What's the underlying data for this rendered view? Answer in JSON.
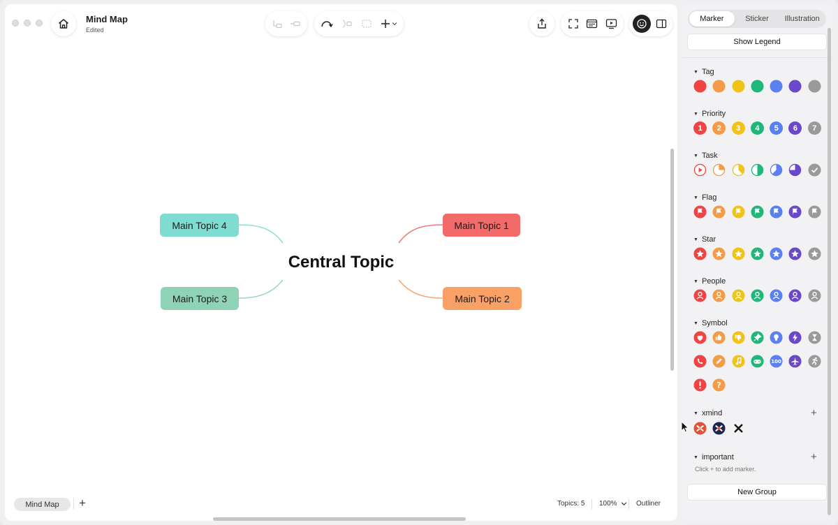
{
  "window": {
    "title": "Mind Map",
    "subtitle": "Edited"
  },
  "map": {
    "central": "Central Topic",
    "topics": [
      {
        "label": "Main Topic 1",
        "color": "#f36a6a"
      },
      {
        "label": "Main Topic 2",
        "color": "#f8a066"
      },
      {
        "label": "Main Topic 3",
        "color": "#8ed3b6"
      },
      {
        "label": "Main Topic 4",
        "color": "#7fdcd0"
      }
    ]
  },
  "bottom": {
    "sheet_tab": "Mind Map",
    "add_sheet": "+",
    "topics_count": "Topics: 5",
    "zoom": "100%",
    "outliner": "Outliner"
  },
  "panel": {
    "tabs": [
      "Marker",
      "Sticker",
      "Illustration"
    ],
    "active_tab": "Marker",
    "show_legend": "Show Legend",
    "new_group": "New Group",
    "important_hint": "Click + to add marker.",
    "palette": [
      "#ef4444",
      "#f59a45",
      "#f1c316",
      "#20b77a",
      "#5b80f0",
      "#6b48c9",
      "#9a9a9a"
    ],
    "groups": [
      {
        "name": "Tag",
        "icons": [
          "dot",
          "dot",
          "dot",
          "dot",
          "dot",
          "dot",
          "dot"
        ]
      },
      {
        "name": "Priority",
        "icons": [
          "1",
          "2",
          "3",
          "4",
          "5",
          "6",
          "7"
        ]
      },
      {
        "name": "Task",
        "icons": [
          "task-start",
          "task-quarter",
          "task-third",
          "task-half",
          "task-two-thirds",
          "task-three-quarters",
          "task-done"
        ]
      },
      {
        "name": "Flag",
        "icons": [
          "flag",
          "flag",
          "flag",
          "flag",
          "flag",
          "flag",
          "flag"
        ]
      },
      {
        "name": "Star",
        "icons": [
          "star",
          "star",
          "star",
          "star",
          "star",
          "star",
          "star"
        ]
      },
      {
        "name": "People",
        "icons": [
          "person",
          "person",
          "person",
          "person",
          "person",
          "person",
          "person"
        ]
      },
      {
        "name": "Symbol",
        "icons": [
          "heart",
          "thumbs-up",
          "thumbs-down",
          "pin",
          "lightbulb",
          "lightning",
          "hourglass",
          "phone",
          "pencil",
          "music-note",
          "game-controller",
          "hundred",
          "airplane",
          "runner",
          "exclamation",
          "question"
        ]
      },
      {
        "name": "xmind",
        "icons": [
          "xmind-logo-red",
          "xmind-logo-dark",
          "xmind-logo-black"
        ]
      },
      {
        "name": "important",
        "icons": []
      }
    ]
  }
}
